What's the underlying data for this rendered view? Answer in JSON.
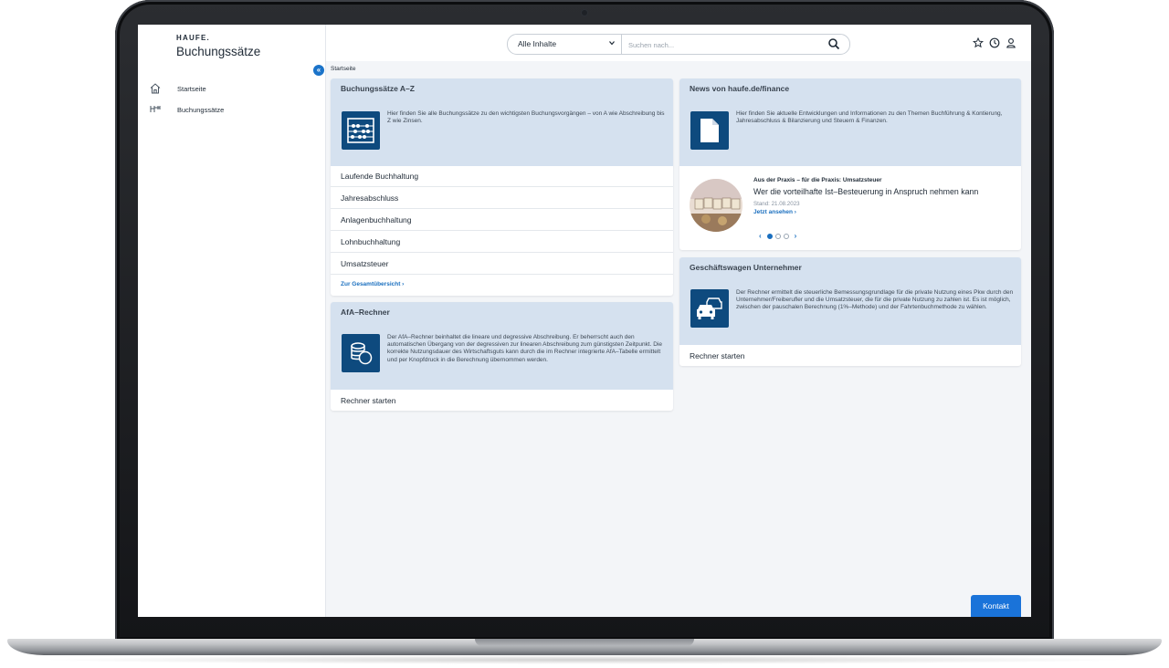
{
  "sidebar": {
    "brand_small": "HAUFE.",
    "brand_title": "Buchungssätze",
    "items": [
      {
        "label": "Startseite",
        "icon": "home-icon"
      },
      {
        "label": "Buchungssätze",
        "icon": "tree-icon"
      }
    ],
    "collapse_icon": "double-chevron-left-icon"
  },
  "header": {
    "search_scope": "Alle Inhalte",
    "search_placeholder": "Suchen nach...",
    "icons": [
      "star-icon",
      "clock-icon",
      "user-icon"
    ]
  },
  "breadcrumb": {
    "current": "Startseite"
  },
  "cards": {
    "az": {
      "title": "Buchungssätze A–Z",
      "description": "Hier finden Sie alle Buchungssätze zu den wichtigsten Buchungsvorgängen – von A wie Abschreibung bis Z wie Zinsen.",
      "icon": "abacus-icon",
      "links": [
        "Laufende Buchhaltung",
        "Jahresabschluss",
        "Anlagenbuchhaltung",
        "Lohnbuchhaltung",
        "Umsatzsteuer"
      ],
      "more_link": "Zur Gesamtübersicht ›"
    },
    "afa": {
      "title": "AfA–Rechner",
      "description": "Der AfA–Rechner beinhaltet die lineare und degressive Abschreibung. Er beherrscht auch den automatischen Übergang von der degressiven zur linearen Abschreibung zum günstigsten Zeitpunkt. Die korrekte Nutzungsdauer des Wirtschaftsguts kann durch die im Rechner integrierte AfA–Tabelle ermittelt und per Knopfdruck in die Berechnung übernommen werden.",
      "icon": "coins-icon",
      "action": "Rechner starten"
    },
    "news": {
      "title": "News von haufe.de/finance",
      "description": "Hier finden Sie aktuelle Entwicklungen und Informationen zu den Themen Buchführung & Kontierung, Jahresabschluss & Bilanzierung und Steuern & Finanzen.",
      "icon": "document-icon",
      "item": {
        "kicker": "Aus der Praxis – für die Praxis: Umsatzsteuer",
        "headline": "Wer die vorteilhafte Ist–Besteuerung in Anspruch nehmen kann",
        "date": "Stand: 21.08.2023",
        "link": "Jetzt ansehen ›",
        "image": "steuer-letter-tiles-image"
      },
      "carousel": {
        "active_index": 1,
        "count": 3
      }
    },
    "gw": {
      "title": "Geschäftswagen Unternehmer",
      "description": "Der Rechner ermittelt die steuerliche Bemessungsgrundlage für die private Nutzung eines Pkw durch den Unternehmer/Freiberufler und die Umsatzsteuer, die für die private Nutzung zu zahlen ist. Es ist möglich, zwischen der pauschalen Berechnung (1%–Methode) und der Fahrtenbuchmethode zu wählen.",
      "icon": "cars-icon",
      "action": "Rechner starten"
    }
  },
  "kontakt_label": "Kontakt",
  "colors": {
    "card_header": "#d5e1ef",
    "icon_tile": "#0e4a7e",
    "link_blue": "#1a6fbf",
    "button_blue": "#1a73d9"
  }
}
